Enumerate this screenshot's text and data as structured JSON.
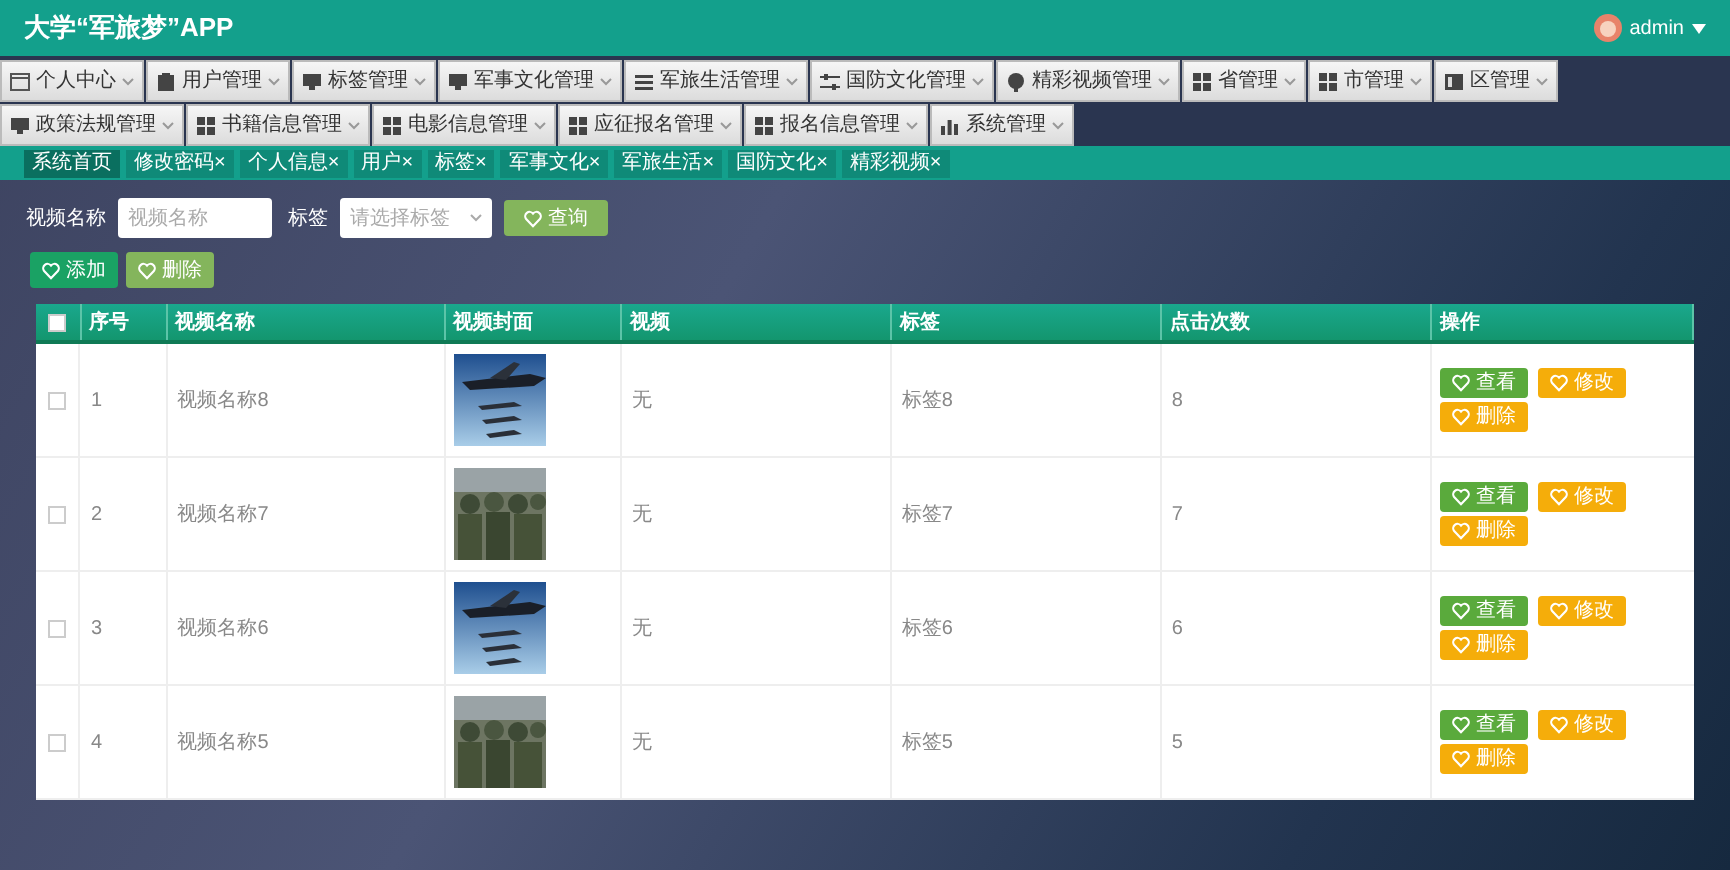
{
  "header": {
    "title": "大学“军旅梦”APP",
    "user": "admin"
  },
  "menu": [
    {
      "label": "个人中心"
    },
    {
      "label": "用户管理"
    },
    {
      "label": "标签管理"
    },
    {
      "label": "军事文化管理"
    },
    {
      "label": "军旅生活管理"
    },
    {
      "label": "国防文化管理"
    },
    {
      "label": "精彩视频管理"
    },
    {
      "label": "省管理"
    },
    {
      "label": "市管理"
    },
    {
      "label": "区管理"
    },
    {
      "label": "政策法规管理"
    },
    {
      "label": "书籍信息管理"
    },
    {
      "label": "电影信息管理"
    },
    {
      "label": "应征报名管理"
    },
    {
      "label": "报名信息管理"
    },
    {
      "label": "系统管理"
    }
  ],
  "tabs": [
    {
      "label": "系统首页",
      "selected": true
    },
    {
      "label": "修改密码",
      "close": "×",
      "selected": false
    },
    {
      "label": "个人信息",
      "close": "×",
      "selected": false
    },
    {
      "label": "用户",
      "close": "×",
      "selected": false
    },
    {
      "label": "标签",
      "close": "×",
      "selected": false
    },
    {
      "label": "军事文化",
      "close": "×",
      "selected": false
    },
    {
      "label": "军旅生活",
      "close": "×",
      "selected": false
    },
    {
      "label": "国防文化",
      "close": "×",
      "selected": false
    },
    {
      "label": "精彩视频",
      "close": "×",
      "selected": false
    }
  ],
  "search": {
    "name_label": "视频名称",
    "name_placeholder": "视频名称",
    "tag_label": "标签",
    "tag_placeholder": "请选择标签",
    "button": "查询"
  },
  "actions": [
    "添加",
    "删除"
  ],
  "table": {
    "select_all_checked": false,
    "columns": [
      "序号",
      "视频名称",
      "视频封面",
      "视频",
      "标签",
      "点击次数",
      "操作"
    ],
    "rows": [
      {
        "checked": false,
        "index": "1",
        "name": "视频名称8",
        "video": "无",
        "tag": "标签8",
        "clicks": "8",
        "buttons": [
          "查看",
          "修改",
          "删除"
        ]
      },
      {
        "checked": false,
        "index": "2",
        "name": "视频名称7",
        "video": "无",
        "tag": "标签7",
        "clicks": "7",
        "buttons": [
          "查看",
          "修改",
          "删除"
        ]
      },
      {
        "checked": false,
        "index": "3",
        "name": "视频名称6",
        "video": "无",
        "tag": "标签6",
        "clicks": "6",
        "buttons": [
          "查看",
          "修改",
          "删除"
        ]
      },
      {
        "checked": false,
        "index": "4",
        "name": "视频名称5",
        "video": "无",
        "tag": "标签5",
        "clicks": "5",
        "buttons": [
          "查看",
          "修改",
          "删除"
        ]
      }
    ]
  }
}
